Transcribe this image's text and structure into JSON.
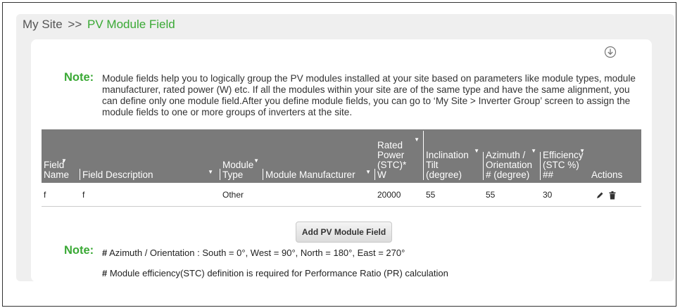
{
  "breadcrumb": {
    "root": "My Site",
    "separator": ">>",
    "current": "PV Module Field"
  },
  "note_top": {
    "label": "Note:",
    "text": "Module fields help you to logically group the PV modules installed at your site based on parameters like module types, module manufacturer, rated power (W) etc. If all the modules within your site are of the same type and have the same alignment, you can define only one module field.After you define module fields, you can go to ‘My Site > Inverter Group’ screen to assign the module fields to one or more groups of inverters at the site."
  },
  "table": {
    "headers": {
      "field_name": "Field Name",
      "field_description": "Field Description",
      "module_type": "Module Type",
      "module_manufacturer": "Module Manufacturer",
      "rated_power": "Rated Power (STC)* W",
      "inclination_tilt": "Inclination Tilt (degree)",
      "azimuth": "Azimuth / Orientation # (degree)",
      "efficiency": "Efficiency (STC %) ##",
      "actions": "Actions"
    },
    "rows": [
      {
        "field_name": "f",
        "field_description": "f",
        "module_type": "Other",
        "module_manufacturer": "",
        "rated_power": "20000",
        "inclination_tilt": "55",
        "azimuth": "55",
        "efficiency": "30"
      }
    ]
  },
  "add_button": {
    "label": "Add PV Module Field"
  },
  "note_bottom": {
    "label": "Note:",
    "line1_hash": "#",
    "line1": " Azimuth / Orientation : South = 0°, West = 90°, North = 180°, East = 270°",
    "line2_hash": "#",
    "line2": " Module efficiency(STC) definition is required for Performance Ratio (PR) calculation"
  },
  "colors": {
    "accent_green": "#3aa935",
    "header_gray": "#7a7a7a",
    "panel_gray": "#efefef"
  },
  "icons": [
    "download-icon",
    "pencil-icon",
    "trash-icon",
    "sort-caret-icon"
  ]
}
